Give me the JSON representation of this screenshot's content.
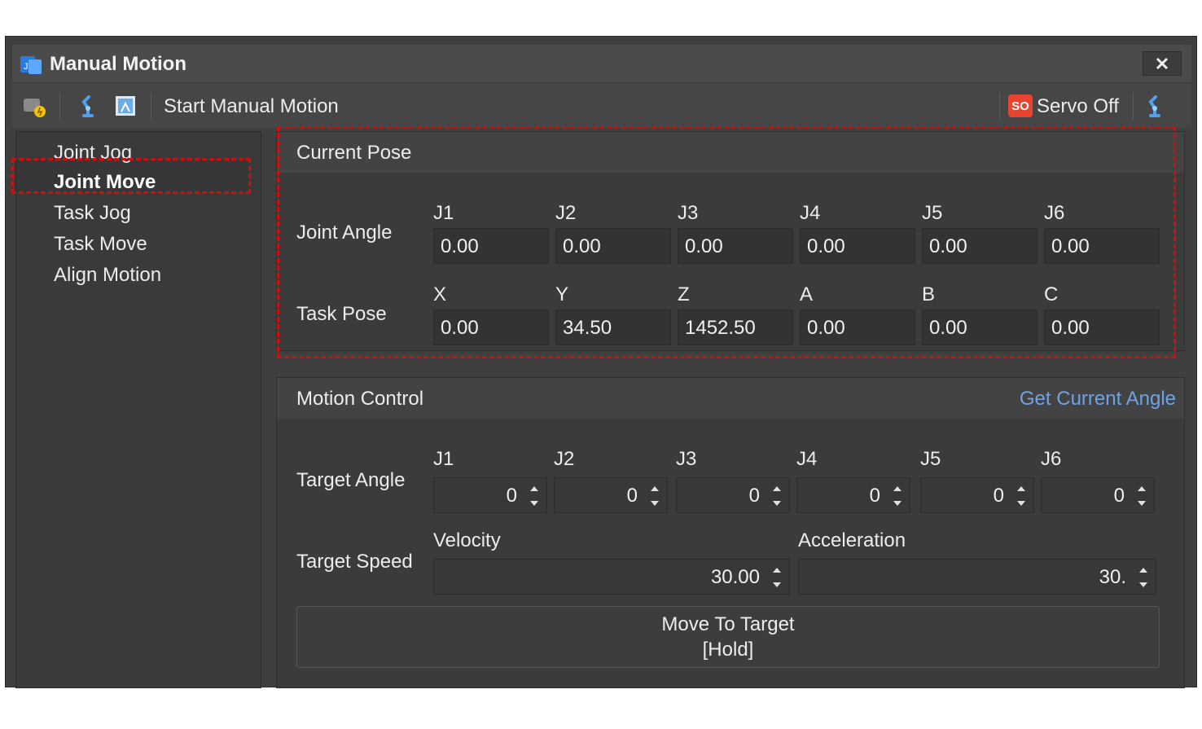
{
  "window": {
    "title": "Manual Motion",
    "close_glyph": "✕"
  },
  "toolbar": {
    "start_label": "Start Manual Motion",
    "servo_badge": "SO",
    "servo_label": "Servo Off",
    "icons": [
      "connect-icon",
      "robot-arm-icon",
      "frame-icon",
      "robot-arm-icon"
    ]
  },
  "sidebar": {
    "items": [
      {
        "label": "Joint Jog"
      },
      {
        "label": "Joint Move"
      },
      {
        "label": "Task Jog"
      },
      {
        "label": "Task Move"
      },
      {
        "label": "Align Motion"
      }
    ],
    "active": "Joint Move"
  },
  "current_pose": {
    "title": "Current Pose",
    "joint_angle_label": "Joint Angle",
    "task_pose_label": "Task Pose",
    "joint_headers": [
      "J1",
      "J2",
      "J3",
      "J4",
      "J5",
      "J6"
    ],
    "joint_values": [
      "0.00",
      "0.00",
      "0.00",
      "0.00",
      "0.00",
      "0.00"
    ],
    "task_headers": [
      "X",
      "Y",
      "Z",
      "A",
      "B",
      "C"
    ],
    "task_values": [
      "0.00",
      "34.50",
      "1452.50",
      "0.00",
      "0.00",
      "0.00"
    ]
  },
  "motion_control": {
    "title": "Motion Control",
    "get_current_angle": "Get Current Angle",
    "target_angle_label": "Target Angle",
    "target_headers": [
      "J1",
      "J2",
      "J3",
      "J4",
      "J5",
      "J6"
    ],
    "target_values": [
      "0",
      "0",
      "0",
      "0",
      "0",
      "0"
    ],
    "target_speed_label": "Target Speed",
    "velocity_label": "Velocity",
    "velocity_value": "30.00",
    "acceleration_label": "Acceleration",
    "acceleration_value": "30.",
    "move_button_line1": "Move To Target",
    "move_button_line2": "[Hold]"
  },
  "colors": {
    "highlight": "#cc1111",
    "link": "#6ea3e6",
    "servo_badge": "#e8442f"
  }
}
